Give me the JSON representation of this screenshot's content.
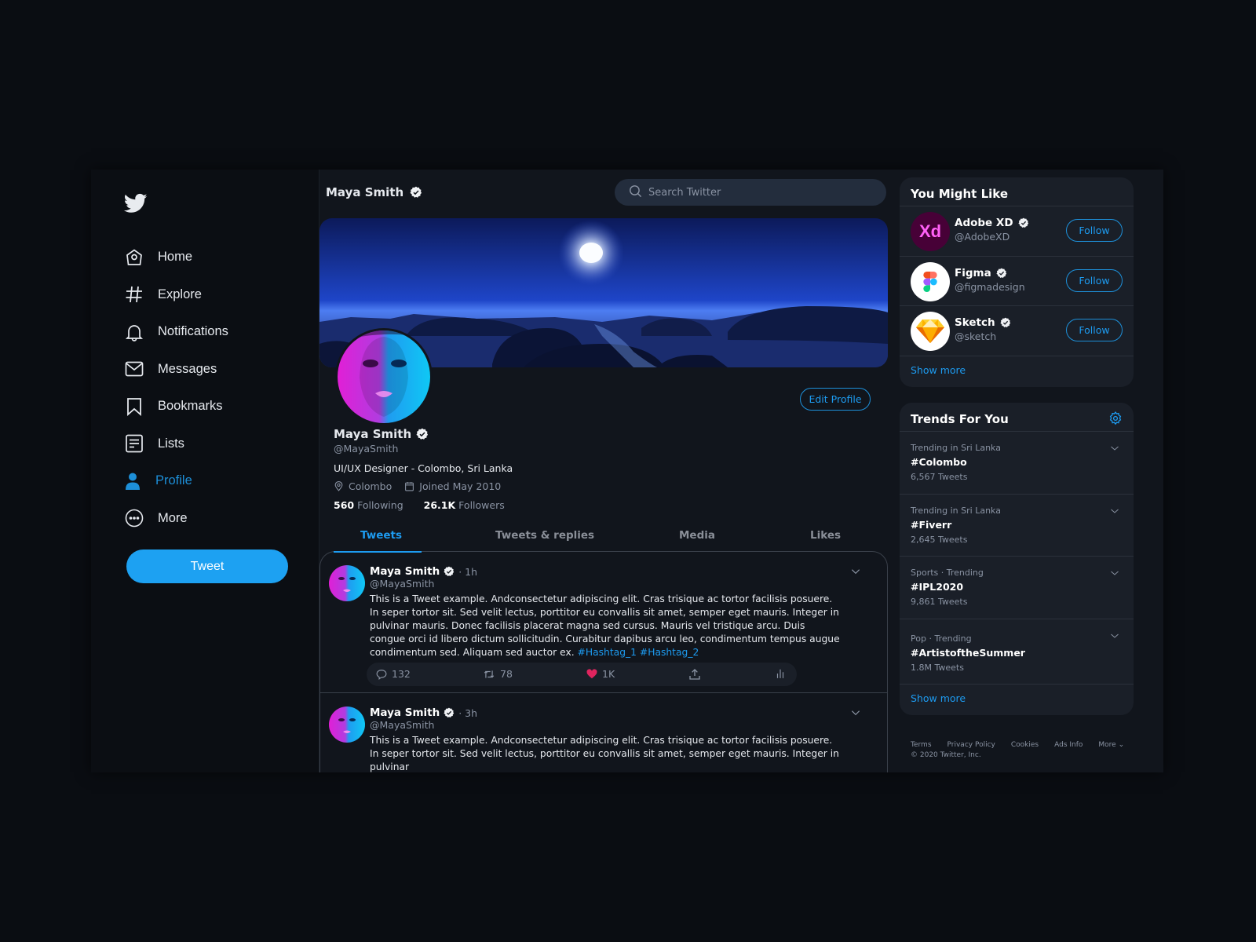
{
  "sidebar": {
    "logo": "twitter-bird-icon",
    "items": [
      {
        "label": "Home",
        "icon": "home-icon"
      },
      {
        "label": "Explore",
        "icon": "hashtag-icon"
      },
      {
        "label": "Notifications",
        "icon": "bell-icon"
      },
      {
        "label": "Messages",
        "icon": "mail-icon"
      },
      {
        "label": "Bookmarks",
        "icon": "bookmark-icon"
      },
      {
        "label": "Lists",
        "icon": "list-icon"
      },
      {
        "label": "Profile",
        "icon": "user-icon",
        "active": true
      },
      {
        "label": "More",
        "icon": "more-icon"
      }
    ],
    "tweet_button": "Tweet"
  },
  "header": {
    "name": "Maya Smith",
    "search_placeholder": "Search Twitter"
  },
  "profile": {
    "name": "Maya Smith",
    "handle": "@MayaSmith",
    "bio": "UI/UX Designer - Colombo, Sri Lanka",
    "location": "Colombo",
    "joined": "Joined May 2010",
    "following_count": "560",
    "following_label": "Following",
    "followers_count": "26.1K",
    "followers_label": "Followers",
    "edit_button": "Edit Profile"
  },
  "tabs": [
    {
      "label": "Tweets",
      "active": true
    },
    {
      "label": "Tweets & replies"
    },
    {
      "label": "Media"
    },
    {
      "label": "Likes"
    }
  ],
  "tweets": [
    {
      "name": "Maya Smith",
      "time": "· 1h",
      "handle": "@MayaSmith",
      "text": "This is a Tweet example. Andconsectetur adipiscing elit. Cras trisique ac tortor facilisis posuere. In seper tortor sit. Sed velit lectus, porttitor eu convallis sit amet, semper eget mauris. Integer in pulvinar mauris. Donec facilisis placerat magna sed cursus. Mauris vel tristique arcu. Duis congue orci id libero dictum sollicitudin. Curabitur dapibus arcu leo, condimentum tempus augue condimentum sed. Aliquam sed auctor ex.",
      "hashtags": [
        "#Hashtag_1",
        "#Hashtag_2"
      ],
      "replies": "132",
      "retweets": "78",
      "likes": "1K"
    },
    {
      "name": "Maya Smith",
      "time": "· 3h",
      "handle": "@MayaSmith",
      "text": "This is a Tweet example. Andconsectetur adipiscing elit. Cras trisique ac tortor facilisis posuere. In seper tortor sit. Sed velit lectus, porttitor eu convallis sit amet, semper eget mauris. Integer in pulvinar"
    }
  ],
  "suggestions": {
    "title": "You Might Like",
    "items": [
      {
        "name": "Adobe XD",
        "handle": "@AdobeXD",
        "logo_text": "Xd",
        "button": "Follow"
      },
      {
        "name": "Figma",
        "handle": "@figmadesign",
        "button": "Follow"
      },
      {
        "name": "Sketch",
        "handle": "@sketch",
        "button": "Follow"
      }
    ],
    "show_more": "Show more"
  },
  "trends": {
    "title": "Trends For You",
    "items": [
      {
        "context": "Trending in Sri Lanka",
        "tag": "#Colombo",
        "count": "6,567 Tweets"
      },
      {
        "context": "Trending in Sri Lanka",
        "tag": "#Fiverr",
        "count": "2,645 Tweets"
      },
      {
        "context": "Sports  ·  Trending",
        "tag": "#IPL2020",
        "count": "9,861 Tweets"
      },
      {
        "context": "Pop  ·  Trending",
        "tag": "#ArtistoftheSummer",
        "count": "1.8M Tweets"
      }
    ],
    "show_more": "Show more"
  },
  "footer": {
    "links": [
      "Terms",
      "Privacy Policy",
      "Cookies",
      "Ads Info",
      "More ⌄"
    ],
    "copyright": "© 2020 Twitter, Inc."
  },
  "colors": {
    "accent": "#1da1f2",
    "like": "#e0245e",
    "background": "#11151c"
  }
}
